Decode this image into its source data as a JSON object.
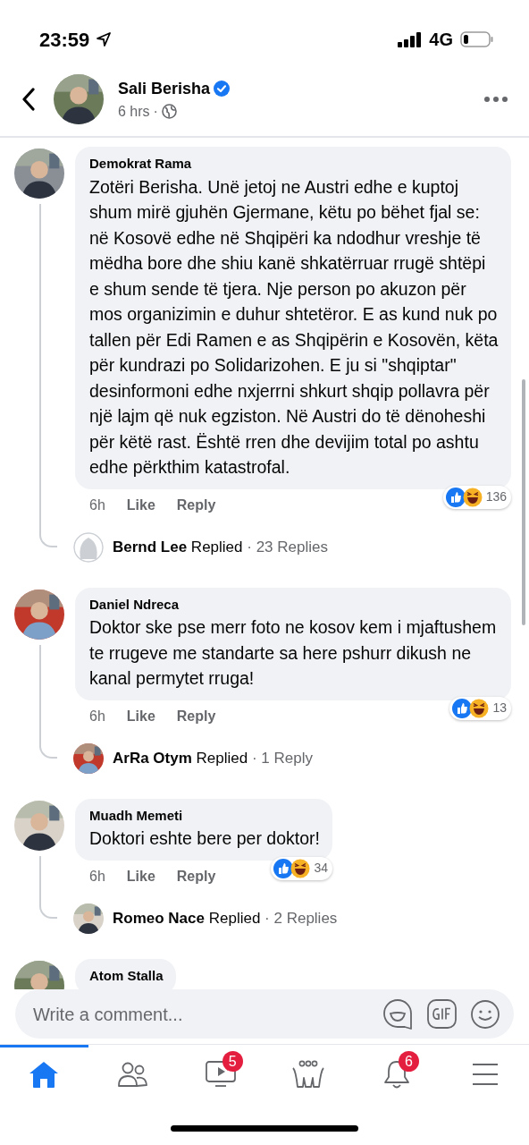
{
  "status_bar": {
    "time": "23:59",
    "network": "4G"
  },
  "header": {
    "name": "Sali Berisha",
    "verified": true,
    "time": "6 hrs",
    "separator": "·"
  },
  "comments": [
    {
      "author": "Demokrat Rama",
      "text": "Zotëri Berisha. Unë jetoj ne Austri edhe e kuptoj shum mirë gjuhën Gjermane, këtu po bëhet fjal se: në Kosovë edhe në Shqipëri ka ndodhur vreshje të mëdha bore dhe shiu kanë shkatërruar rrugë shtëpi e shum sende të tjera. Nje person po akuzon për mos organizimin e duhur shtetëror. E as kund nuk po tallen për Edi Ramen e as Shqipërin e Kosovën, këta për kundrazi po Solidarizohen. E ju si \"shqiptar\" desinformoni edhe nxjerrni shkurt shqip pollavra për një lajm që nuk egziston. Në Austri do të dënoheshi për këtë rast. Është rren dhe devijim total po ashtu edhe përkthim katastrofal.",
      "time": "6h",
      "like": "Like",
      "reply": "Reply",
      "reactions": "136",
      "replies": {
        "author": "Bernd Lee",
        "verb": "Replied",
        "separator": "·",
        "count": "23 Replies",
        "kind": "blank"
      }
    },
    {
      "author": "Daniel Ndreca",
      "text": "Doktor ske pse merr foto ne kosov kem i mjaftushem te rrugeve me standarte sa here pshurr dikush ne kanal permytet rruga!",
      "time": "6h",
      "like": "Like",
      "reply": "Reply",
      "reactions": "13",
      "replies": {
        "author": "ArRa Otym",
        "verb": "Replied",
        "separator": "·",
        "count": "1 Reply",
        "kind": "picture"
      }
    },
    {
      "author": "Muadh Memeti",
      "text": "Doktori eshte bere per doktor!",
      "time": "6h",
      "like": "Like",
      "reply": "Reply",
      "reactions": "34",
      "replies": {
        "author": "Romeo Nace",
        "verb": "Replied",
        "separator": "·",
        "count": "2 Replies",
        "kind": "picture"
      }
    },
    {
      "author": "Atom Stalla"
    }
  ],
  "composer": {
    "placeholder": "Write a comment..."
  },
  "tabs": [
    {
      "kind": "home",
      "selected": true
    },
    {
      "kind": "friends",
      "selected": false
    },
    {
      "kind": "watch",
      "selected": false,
      "badge": "5"
    },
    {
      "kind": "groups",
      "selected": false
    },
    {
      "kind": "notifications",
      "selected": false,
      "badge": "6"
    },
    {
      "kind": "menu",
      "selected": false
    }
  ]
}
